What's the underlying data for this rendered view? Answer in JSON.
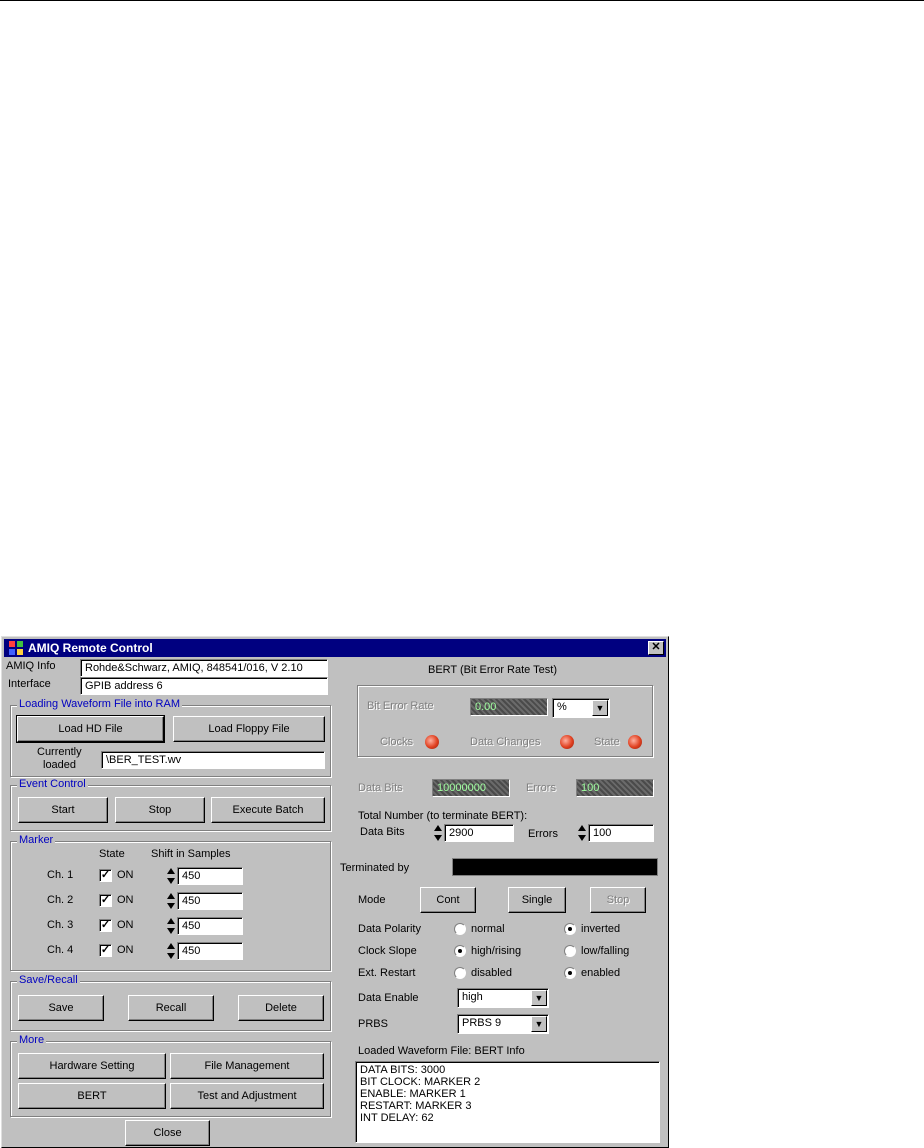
{
  "window": {
    "title": "AMIQ Remote Control"
  },
  "info": {
    "amiq_label": "AMIQ Info",
    "amiq_value": "Rohde&Schwarz, AMIQ, 848541/016, V 2.10",
    "interface_label": "Interface",
    "interface_value": "GPIB address 6"
  },
  "loading": {
    "title": "Loading Waveform File into RAM",
    "load_hd": "Load HD File",
    "load_floppy": "Load Floppy File",
    "currently_loaded_label_1": "Currently",
    "currently_loaded_label_2": "loaded",
    "currently_loaded_value": "\\BER_TEST.wv"
  },
  "event_control": {
    "title": "Event Control",
    "start": "Start",
    "stop": "Stop",
    "execute_batch": "Execute Batch"
  },
  "marker": {
    "title": "Marker",
    "col_state": "State",
    "col_shift": "Shift in Samples",
    "rows": [
      {
        "label": "Ch. 1",
        "state": "ON",
        "checked": true,
        "shift": "450"
      },
      {
        "label": "Ch. 2",
        "state": "ON",
        "checked": true,
        "shift": "450"
      },
      {
        "label": "Ch. 3",
        "state": "ON",
        "checked": true,
        "shift": "450"
      },
      {
        "label": "Ch. 4",
        "state": "ON",
        "checked": true,
        "shift": "450"
      }
    ]
  },
  "save_recall": {
    "title": "Save/Recall",
    "save": "Save",
    "recall": "Recall",
    "delete": "Delete"
  },
  "more": {
    "title": "More",
    "hardware_setting": "Hardware Setting",
    "file_management": "File Management",
    "bert": "BERT",
    "test_adjustment": "Test and Adjustment"
  },
  "close": "Close",
  "bert": {
    "title": "BERT (Bit Error Rate Test)",
    "bit_error_rate_label": "Bit Error Rate",
    "bit_error_rate_value": "0.00",
    "unit_value": "%",
    "clocks_label": "Clocks",
    "data_changes_label": "Data Changes",
    "state_label": "State",
    "data_bits_label": "Data Bits",
    "data_bits_value": "10000000",
    "errors_label": "Errors",
    "errors_value": "100",
    "total_number_label": "Total Number (to terminate BERT):",
    "total_data_bits_label": "Data Bits",
    "total_data_bits_value": "2900",
    "total_errors_label": "Errors",
    "total_errors_value": "100",
    "terminated_by_label": "Terminated by",
    "terminated_by_color": "#000000",
    "mode_label": "Mode",
    "cont": "Cont",
    "single": "Single",
    "stop": "Stop",
    "data_polarity_label": "Data Polarity",
    "normal": "normal",
    "inverted": "inverted",
    "clock_slope_label": "Clock Slope",
    "high_rising": "high/rising",
    "low_falling": "low/falling",
    "ext_restart_label": "Ext. Restart",
    "disabled": "disabled",
    "enabled": "enabled",
    "data_enable_label": "Data Enable",
    "data_enable_value": "high",
    "prbs_label": "PRBS",
    "prbs_value": "PRBS 9",
    "loaded_info_label": "Loaded Waveform File: BERT Info",
    "loaded_info_lines": [
      "DATA BITS: 3000",
      "BIT CLOCK: MARKER 2",
      "ENABLE: MARKER 1",
      "RESTART: MARKER 3",
      "INT DELAY: 62"
    ]
  },
  "colors": {
    "face": "#c0c0c0",
    "titlebar": "#000080",
    "group_title": "#0000c0",
    "led": "#e04020"
  }
}
